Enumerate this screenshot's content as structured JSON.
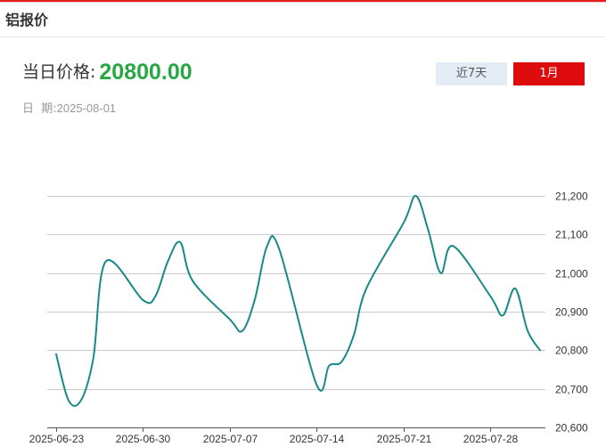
{
  "header": {
    "title": "铝报价"
  },
  "summary": {
    "price_label": "当日价格:",
    "price_value": "20800.00",
    "date_label": "日  期:",
    "date_value": "2025-08-01"
  },
  "range_buttons": {
    "seven_day": "近7天",
    "one_month": "1月",
    "selected": "1月"
  },
  "colors": {
    "line": "#178a88",
    "price": "#27a844",
    "active_button": "#dd0b0b",
    "inactive_button": "#e3ecf5",
    "grid": "#cccccc",
    "header_rule": "#e01e1e"
  },
  "chart_data": {
    "type": "line",
    "title": "",
    "xlabel": "",
    "ylabel": "",
    "grid": true,
    "y_axis_side": "right",
    "ylim": [
      20600,
      21200
    ],
    "y_ticks": [
      20600,
      20700,
      20800,
      20900,
      21000,
      21100,
      21200
    ],
    "y_tick_labels": [
      "20,600",
      "20,700",
      "20,800",
      "20,900",
      "21,000",
      "21,100",
      "21,200"
    ],
    "x_ticks": [
      "2025-06-23",
      "2025-06-30",
      "2025-07-07",
      "2025-07-14",
      "2025-07-21",
      "2025-07-28"
    ],
    "series": [
      {
        "x": [
          "2025-06-23",
          "2025-06-24",
          "2025-06-25",
          "2025-06-26",
          "2025-06-27",
          "2025-06-30",
          "2025-07-01",
          "2025-07-02",
          "2025-07-03",
          "2025-07-04",
          "2025-07-07",
          "2025-07-08",
          "2025-07-09",
          "2025-07-10",
          "2025-07-11",
          "2025-07-14",
          "2025-07-15",
          "2025-07-16",
          "2025-07-17",
          "2025-07-18",
          "2025-07-21",
          "2025-07-22",
          "2025-07-23",
          "2025-07-24",
          "2025-07-25",
          "2025-07-28",
          "2025-07-29",
          "2025-07-30",
          "2025-07-31",
          "2025-08-01"
        ],
        "values": [
          20790,
          20670,
          20670,
          20780,
          21030,
          20930,
          20940,
          21030,
          21080,
          20980,
          20880,
          20850,
          20930,
          21070,
          21060,
          20710,
          20760,
          20770,
          20840,
          20960,
          21130,
          21200,
          21110,
          21000,
          21070,
          20940,
          20890,
          20960,
          20850,
          20800
        ]
      }
    ]
  }
}
